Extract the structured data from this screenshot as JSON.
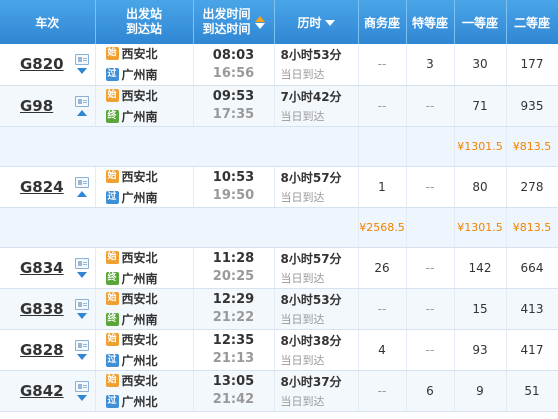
{
  "header": {
    "train_no": "车次",
    "dep_station": "出发站",
    "arr_station": "到达站",
    "dep_time": "出发时间",
    "arr_time": "到达时间",
    "duration": "历时",
    "business": "商务座",
    "premium": "特等座",
    "first": "一等座",
    "second": "二等座"
  },
  "badges": {
    "start": "始",
    "pass": "过",
    "end": "终"
  },
  "rows": [
    {
      "train": "G820",
      "arrow": "down",
      "from": "西安北",
      "from_badge": "始",
      "to": "广州南",
      "to_badge": "过",
      "dep": "08:03",
      "arr": "16:56",
      "duration": "8小时53分",
      "day": "当日到达",
      "business": "--",
      "premium": "3",
      "first": "30",
      "second": "177",
      "alt": false
    },
    {
      "train": "G98",
      "arrow": "up",
      "from": "西安北",
      "from_badge": "始",
      "to": "广州南",
      "to_badge": "终",
      "dep": "09:53",
      "arr": "17:35",
      "duration": "7小时42分",
      "day": "当日到达",
      "business": "--",
      "premium": "--",
      "first": "71",
      "second": "935",
      "alt": true
    },
    {
      "price_row": true,
      "business": "",
      "premium": "",
      "first": "¥1301.5",
      "second": "¥813.5"
    },
    {
      "train": "G824",
      "arrow": "up",
      "from": "西安北",
      "from_badge": "始",
      "to": "广州南",
      "to_badge": "过",
      "dep": "10:53",
      "arr": "19:50",
      "duration": "8小时57分",
      "day": "当日到达",
      "business": "1",
      "premium": "--",
      "first": "80",
      "second": "278",
      "alt": false
    },
    {
      "price_row": true,
      "business": "¥2568.5",
      "premium": "",
      "first": "¥1301.5",
      "second": "¥813.5"
    },
    {
      "train": "G834",
      "arrow": "down",
      "from": "西安北",
      "from_badge": "始",
      "to": "广州南",
      "to_badge": "终",
      "dep": "11:28",
      "arr": "20:25",
      "duration": "8小时57分",
      "day": "当日到达",
      "business": "26",
      "premium": "--",
      "first": "142",
      "second": "664",
      "alt": false
    },
    {
      "train": "G838",
      "arrow": "down",
      "from": "西安北",
      "from_badge": "始",
      "to": "广州南",
      "to_badge": "终",
      "dep": "12:29",
      "arr": "21:22",
      "duration": "8小时53分",
      "day": "当日到达",
      "business": "--",
      "premium": "--",
      "first": "15",
      "second": "413",
      "alt": true
    },
    {
      "train": "G828",
      "arrow": "down",
      "from": "西安北",
      "from_badge": "始",
      "to": "广州北",
      "to_badge": "过",
      "dep": "12:35",
      "arr": "21:13",
      "duration": "8小时38分",
      "day": "当日到达",
      "business": "4",
      "premium": "--",
      "first": "93",
      "second": "417",
      "alt": false
    },
    {
      "train": "G842",
      "arrow": "down",
      "from": "西安北",
      "from_badge": "始",
      "to": "广州北",
      "to_badge": "过",
      "dep": "13:05",
      "arr": "21:42",
      "duration": "8小时37分",
      "day": "当日到达",
      "business": "--",
      "premium": "6",
      "first": "9",
      "second": "51",
      "alt": true
    }
  ]
}
